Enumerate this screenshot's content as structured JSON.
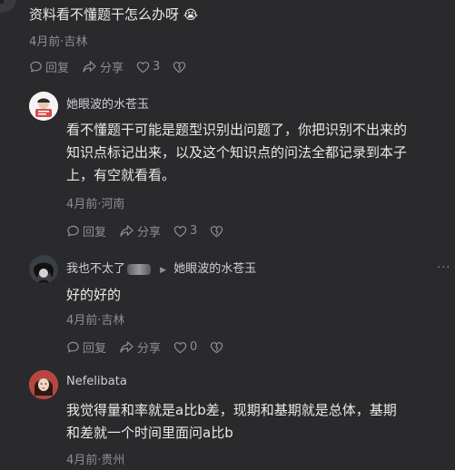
{
  "comments": [
    {
      "content": "资料看不懂题干怎么办呀",
      "emoji": "😭",
      "meta": "4月前·吉林",
      "reply": "回复",
      "share": "分享",
      "likes": "3"
    },
    {
      "author": "她眼波的水苍玉",
      "content_line1": "看不懂题干可能是题型识别出问题了，你把识别不出来的",
      "content_line2": "知识点标记出来，以及这个知识点的问法全都记录到本子",
      "content_line3": "上，有空就看看。",
      "meta": "4月前·河南",
      "reply": "回复",
      "share": "分享",
      "likes": "3"
    },
    {
      "author": "我也不太了",
      "reply_to": "她眼波的水苍玉",
      "content": "好的好的",
      "meta": "4月前·吉林",
      "reply": "回复",
      "share": "分享",
      "likes": "0"
    },
    {
      "author": "Nefelibata",
      "content_line1": "我觉得量和率就是a比b差，现期和基期就是总体，基期",
      "content_line2": "和差就一个时间里面问a比b",
      "meta": "4月前·贵州"
    }
  ],
  "more_label": "···",
  "colors": {
    "background": "#2a2a2c",
    "text": "#e9e9e9",
    "meta": "#8e8e93"
  }
}
